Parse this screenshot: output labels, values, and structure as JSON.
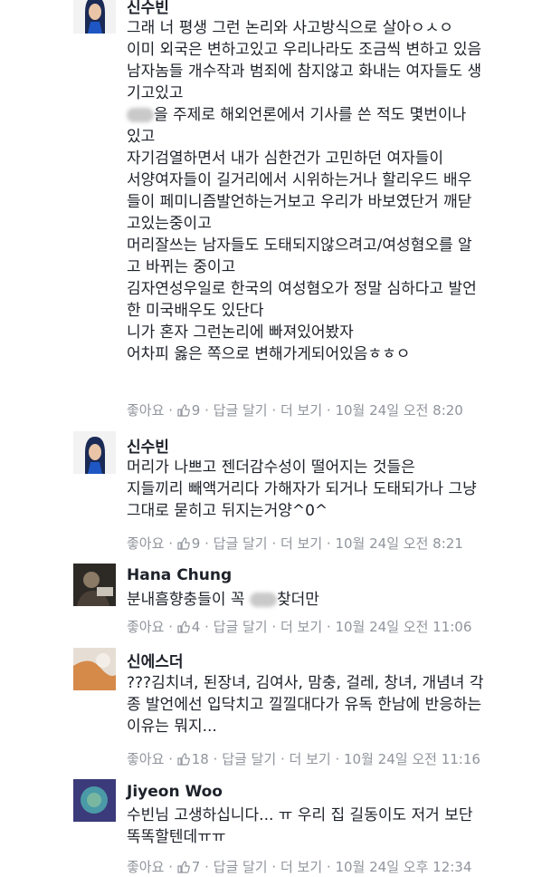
{
  "action_labels": {
    "like": "좋아요",
    "reply": "답글 달기",
    "more": "더 보기",
    "sep": "·"
  },
  "comments": [
    {
      "name": "신수빈",
      "lines": [
        "그래 너 평생 그런 논리와 사고방식으로 살아ㅇㅅㅇ",
        "이미 외국은 변하고있고 우리나라도 조금씩 변하고 있음",
        "남자놈들 개수작과 범죄에 참지않고 화내는 여자들도 생",
        "기고있고",
        "을 주제로 해외언론에서 기사를 쓴 적도 몇번이나",
        "있고",
        "자기검열하면서 내가 심한건가 고민하던 여자들이",
        "서양여자들이 길거리에서 시위하는거나 할리우드 배우",
        "들이 페미니즘발언하는거보고 우리가 바보였단거 깨닫",
        "고있는중이고",
        "머리잘쓰는 남자들도 도태되지않으려고/여성혐오를 알",
        "고 바뀌는 중이고",
        "김자연성우일로 한국의 여성혐오가 정말 심하다고 발언",
        "한 미국배우도 있단다",
        "니가 혼자 그런논리에 빠져있어봤자",
        "어차피 옳은 쪽으로 변해가게되어있음ㅎㅎㅇ"
      ],
      "likes": "9",
      "time": "10월 24일 오전 8:20"
    },
    {
      "name": "신수빈",
      "lines": [
        "머리가 나쁘고 젠더감수성이 떨어지는 것들은",
        "지들끼리 빼액거리다 가해자가 되거나 도태되가나 그냥",
        "그대로 묻히고 뒤지는거양^0^"
      ],
      "likes": "9",
      "time": "10월 24일 오전 8:21"
    },
    {
      "name": "Hana Chung",
      "line_pre": "분내흠향충들이 꼭",
      "line_post": "찾더만",
      "likes": "4",
      "time": "10월 24일 오전 11:06"
    },
    {
      "name": "신에스더",
      "lines": [
        "???김치녀, 된장녀, 김여사, 맘충, 걸레, 창녀, 개념녀 각",
        "종 발언에선 입닥치고 낄낄대다가 유독 한남에 반응하는",
        "이유는 뭐지..."
      ],
      "likes": "18",
      "time": "10월 24일 오전 11:16"
    },
    {
      "name": "Jiyeon Woo",
      "lines": [
        "수빈님 고생하십니다... ㅠ 우리 집 길동이도 저거 보단",
        "똑똑할텐데ㅠㅠ"
      ],
      "likes": "7",
      "time": "10월 24일 오후 12:34"
    }
  ],
  "colors": {
    "text": "#1d2129",
    "meta": "#90949c",
    "background": "#ffffff"
  }
}
